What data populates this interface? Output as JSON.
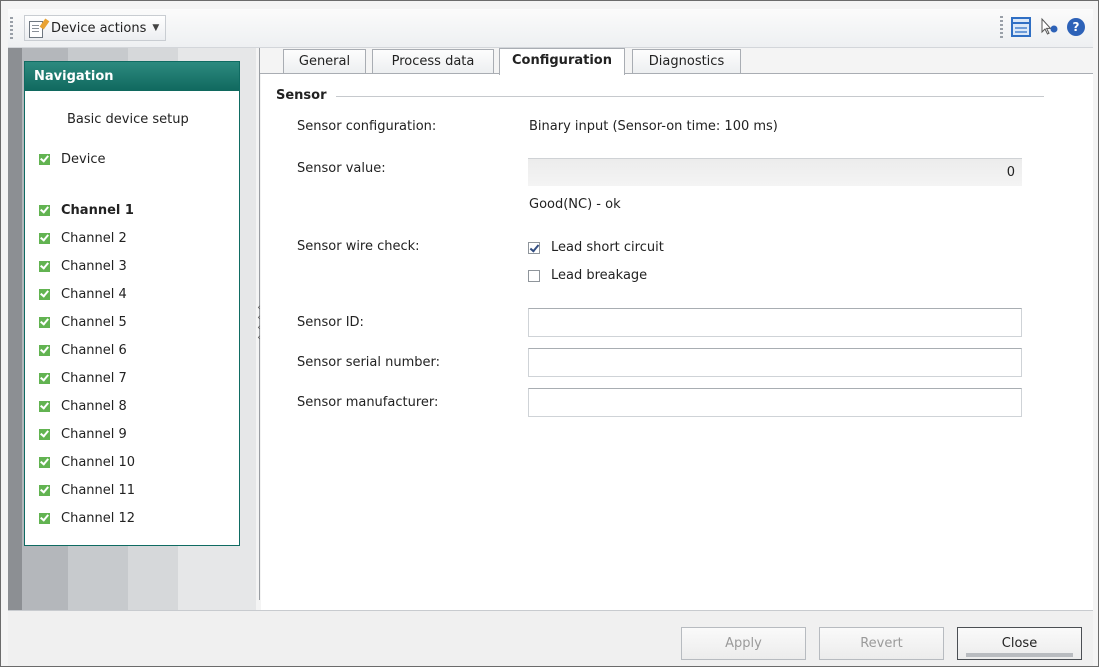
{
  "toolbar": {
    "device_actions_label": "Device actions"
  },
  "navigation": {
    "header": "Navigation",
    "basic_setup": "Basic device setup",
    "items": [
      {
        "label": "Device",
        "checked": true,
        "bold": false
      },
      {
        "label": "Channel 1",
        "checked": true,
        "bold": true
      },
      {
        "label": "Channel 2",
        "checked": true,
        "bold": false
      },
      {
        "label": "Channel 3",
        "checked": true,
        "bold": false
      },
      {
        "label": "Channel 4",
        "checked": true,
        "bold": false
      },
      {
        "label": "Channel 5",
        "checked": true,
        "bold": false
      },
      {
        "label": "Channel 6",
        "checked": true,
        "bold": false
      },
      {
        "label": "Channel 7",
        "checked": true,
        "bold": false
      },
      {
        "label": "Channel 8",
        "checked": true,
        "bold": false
      },
      {
        "label": "Channel 9",
        "checked": true,
        "bold": false
      },
      {
        "label": "Channel 10",
        "checked": true,
        "bold": false
      },
      {
        "label": "Channel 11",
        "checked": true,
        "bold": false
      },
      {
        "label": "Channel 12",
        "checked": true,
        "bold": false
      }
    ]
  },
  "tabs": [
    {
      "label": "General",
      "active": false
    },
    {
      "label": "Process data",
      "active": false
    },
    {
      "label": "Configuration",
      "active": true
    },
    {
      "label": "Diagnostics",
      "active": false
    }
  ],
  "sensor": {
    "section_title": "Sensor",
    "configuration_label": "Sensor configuration:",
    "configuration_value": "Binary input (Sensor-on time: 100 ms)",
    "value_label": "Sensor value:",
    "value": "0",
    "value_status": "Good(NC) - ok",
    "wire_check_label": "Sensor wire check:",
    "lead_short_circuit": {
      "label": "Lead short circuit",
      "checked": true
    },
    "lead_breakage": {
      "label": "Lead breakage",
      "checked": false
    },
    "id_label": "Sensor ID:",
    "id_value": "",
    "serial_label": "Sensor serial number:",
    "serial_value": "",
    "manufacturer_label": "Sensor manufacturer:",
    "manufacturer_value": ""
  },
  "buttons": {
    "apply": "Apply",
    "revert": "Revert",
    "close": "Close"
  }
}
